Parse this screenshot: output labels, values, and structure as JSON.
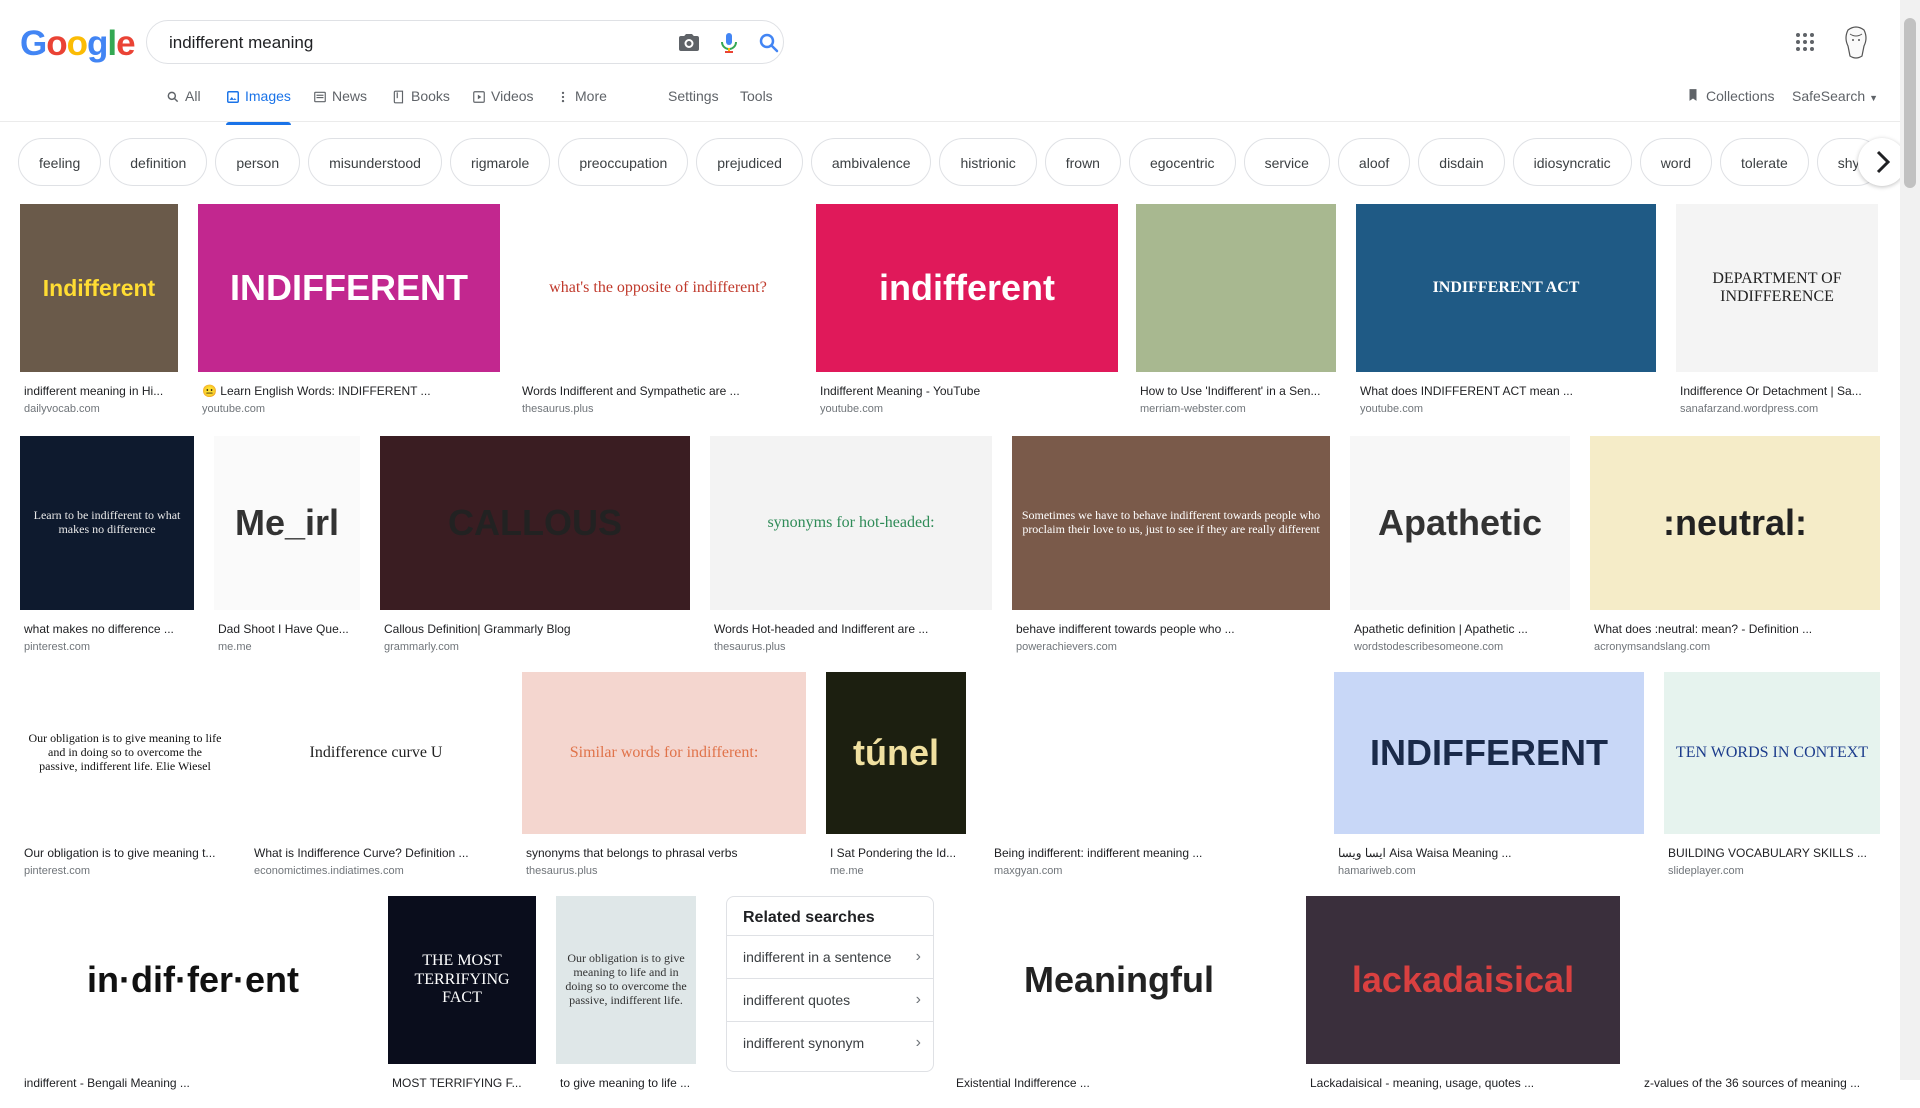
{
  "logo": {
    "letters": [
      "G",
      "o",
      "o",
      "g",
      "l",
      "e"
    ],
    "colors": [
      "#4285f4",
      "#ea4335",
      "#fbbc05",
      "#4285f4",
      "#34a853",
      "#ea4335"
    ]
  },
  "search": {
    "query": "indifferent meaning"
  },
  "tabs": [
    {
      "label": "All",
      "icon": "search-icon"
    },
    {
      "label": "Images",
      "icon": "image-icon",
      "active": true
    },
    {
      "label": "News",
      "icon": "news-icon"
    },
    {
      "label": "Books",
      "icon": "book-icon"
    },
    {
      "label": "Videos",
      "icon": "video-icon"
    },
    {
      "label": "More",
      "icon": "more-vert-icon"
    },
    {
      "label": "Settings"
    },
    {
      "label": "Tools"
    }
  ],
  "header_right": {
    "collections": "Collections",
    "safesearch": "SafeSearch"
  },
  "chips": [
    "feeling",
    "definition",
    "person",
    "misunderstood",
    "rigmarole",
    "preoccupation",
    "prejudiced",
    "ambivalence",
    "histrionic",
    "frown",
    "egocentric",
    "service",
    "aloof",
    "disdain",
    "idiosyncratic",
    "word",
    "tolerate",
    "shy"
  ],
  "results": [
    {
      "title": "indifferent meaning in Hi...",
      "source": "dailyvocab.com",
      "thumb_text": "Indifferent",
      "bg": "#6a5a4a",
      "fg": "#ffdd33"
    },
    {
      "title": "😐 Learn English Words: INDIFFERENT ...",
      "source": "youtube.com",
      "thumb_text": "INDIFFERENT",
      "bg": "#c2278f",
      "fg": "#ffffff"
    },
    {
      "title": "Words Indifferent and Sympathetic are ...",
      "source": "thesaurus.plus",
      "thumb_text": "what's the opposite of indifferent?",
      "bg": "#ffffff",
      "fg": "#c0392b"
    },
    {
      "title": "Indifferent Meaning - YouTube",
      "source": "youtube.com",
      "thumb_text": "indifferent",
      "bg": "#e0195a",
      "fg": "#ffffff"
    },
    {
      "title": "How to Use 'Indifferent' in a Sen...",
      "source": "merriam-webster.com",
      "thumb_text": "",
      "bg": "#a8b890",
      "fg": "#ffffff"
    },
    {
      "title": "What does INDIFFERENT ACT mean ...",
      "source": "youtube.com",
      "thumb_text": "INDIFFERENT ACT",
      "bg": "#1f5a85",
      "fg": "#ffffff"
    },
    {
      "title": "Indifference Or Detachment | Sa...",
      "source": "sanafarzand.wordpress.com",
      "thumb_text": "DEPARTMENT OF INDIFFERENCE",
      "bg": "#f4f4f4",
      "fg": "#222222"
    },
    {
      "title": "what makes no difference ...",
      "source": "pinterest.com",
      "thumb_text": "Learn to be indifferent to what makes no difference",
      "bg": "#0e1a2e",
      "fg": "#e8e8e8"
    },
    {
      "title": "Dad Shoot I Have Que...",
      "source": "me.me",
      "thumb_text": "Me_irl",
      "bg": "#fafafa",
      "fg": "#333333"
    },
    {
      "title": "Callous Definition| Grammarly Blog",
      "source": "grammarly.com",
      "thumb_text": "CALLOUS",
      "bg": "#3a1d22",
      "fg": "#222222"
    },
    {
      "title": "Words Hot-headed and Indifferent are ...",
      "source": "thesaurus.plus",
      "thumb_text": "synonyms for hot-headed:",
      "bg": "#f3f3f3",
      "fg": "#2e8b57"
    },
    {
      "title": "behave indifferent towards people who ...",
      "source": "powerachievers.com",
      "thumb_text": "Sometimes we have to behave indifferent towards people who proclaim their love to us, just to see if they are really different",
      "bg": "#7a5a4a",
      "fg": "#ffffff"
    },
    {
      "title": "Apathetic definition | Apathetic ...",
      "source": "wordstodescribesomeone.com",
      "thumb_text": "Apathetic",
      "bg": "#f7f7f7",
      "fg": "#333333"
    },
    {
      "title": "What does :neutral: mean? - Definition ...",
      "source": "acronymsandslang.com",
      "thumb_text": ":neutral:",
      "bg": "#f5ecc8",
      "fg": "#222222"
    },
    {
      "title": "Our obligation is to give meaning t...",
      "source": "pinterest.com",
      "thumb_text": "Our obligation is to give meaning to life and in doing so to overcome the passive, indifferent life. Elie Wiesel",
      "bg": "#ffffff",
      "fg": "#111111"
    },
    {
      "title": "What is Indifference Curve? Definition ...",
      "source": "economictimes.indiatimes.com",
      "thumb_text": "Indifference curve U",
      "bg": "#ffffff",
      "fg": "#222222"
    },
    {
      "title": "synonyms that belongs to phrasal verbs",
      "source": "thesaurus.plus",
      "thumb_text": "Similar words for indifferent:",
      "bg": "#f4d6cf",
      "fg": "#e0734a"
    },
    {
      "title": "I Sat Pondering the Id...",
      "source": "me.me",
      "thumb_text": "túnel",
      "bg": "#1c1f10",
      "fg": "#f0e0a0"
    },
    {
      "title": "Being indifferent: indifferent meaning ...",
      "source": "maxgyan.com",
      "thumb_text": "",
      "bg": "#ffffff",
      "fg": "#3b78c4"
    },
    {
      "title": "ایسا ویسا Aisa Waisa Meaning ...",
      "source": "hamariweb.com",
      "thumb_text": "INDIFFERENT",
      "bg": "#c8d7f7",
      "fg": "#1a2a4a"
    },
    {
      "title": "BUILDING VOCABULARY SKILLS ...",
      "source": "slideplayer.com",
      "thumb_text": "TEN WORDS IN CONTEXT",
      "bg": "#e6f3ee",
      "fg": "#1c3c8c"
    },
    {
      "title": "indifferent - Bengali Meaning ...",
      "source": "",
      "thumb_text": "in·dif·fer·ent",
      "bg": "#ffffff",
      "fg": "#111111"
    },
    {
      "title": "MOST TERRIFYING F...",
      "source": "",
      "thumb_text": "THE MOST TERRIFYING FACT",
      "bg": "#0a0d1c",
      "fg": "#ffffff"
    },
    {
      "title": "to give meaning to life ...",
      "source": "",
      "thumb_text": "Our obligation is to give meaning to life and in doing so to overcome the passive, indifferent life.",
      "bg": "#dfe7e8",
      "fg": "#333333"
    },
    {
      "title": "Existential Indifference ...",
      "source": "",
      "thumb_text": "Meaningful",
      "bg": "#ffffff",
      "fg": "#222222"
    },
    {
      "title": "Lackadaisical - meaning, usage, quotes ...",
      "source": "",
      "thumb_text": "lackadaisical",
      "bg": "#3a2f3c",
      "fg": "#d94040"
    },
    {
      "title": "z-values of the 36 sources of meaning ...",
      "source": "",
      "thumb_text": "",
      "bg": "#ffffff",
      "fg": "#333333"
    }
  ],
  "related": {
    "heading": "Related searches",
    "items": [
      "indifferent in a sentence",
      "indifferent quotes",
      "indifferent synonym"
    ]
  }
}
